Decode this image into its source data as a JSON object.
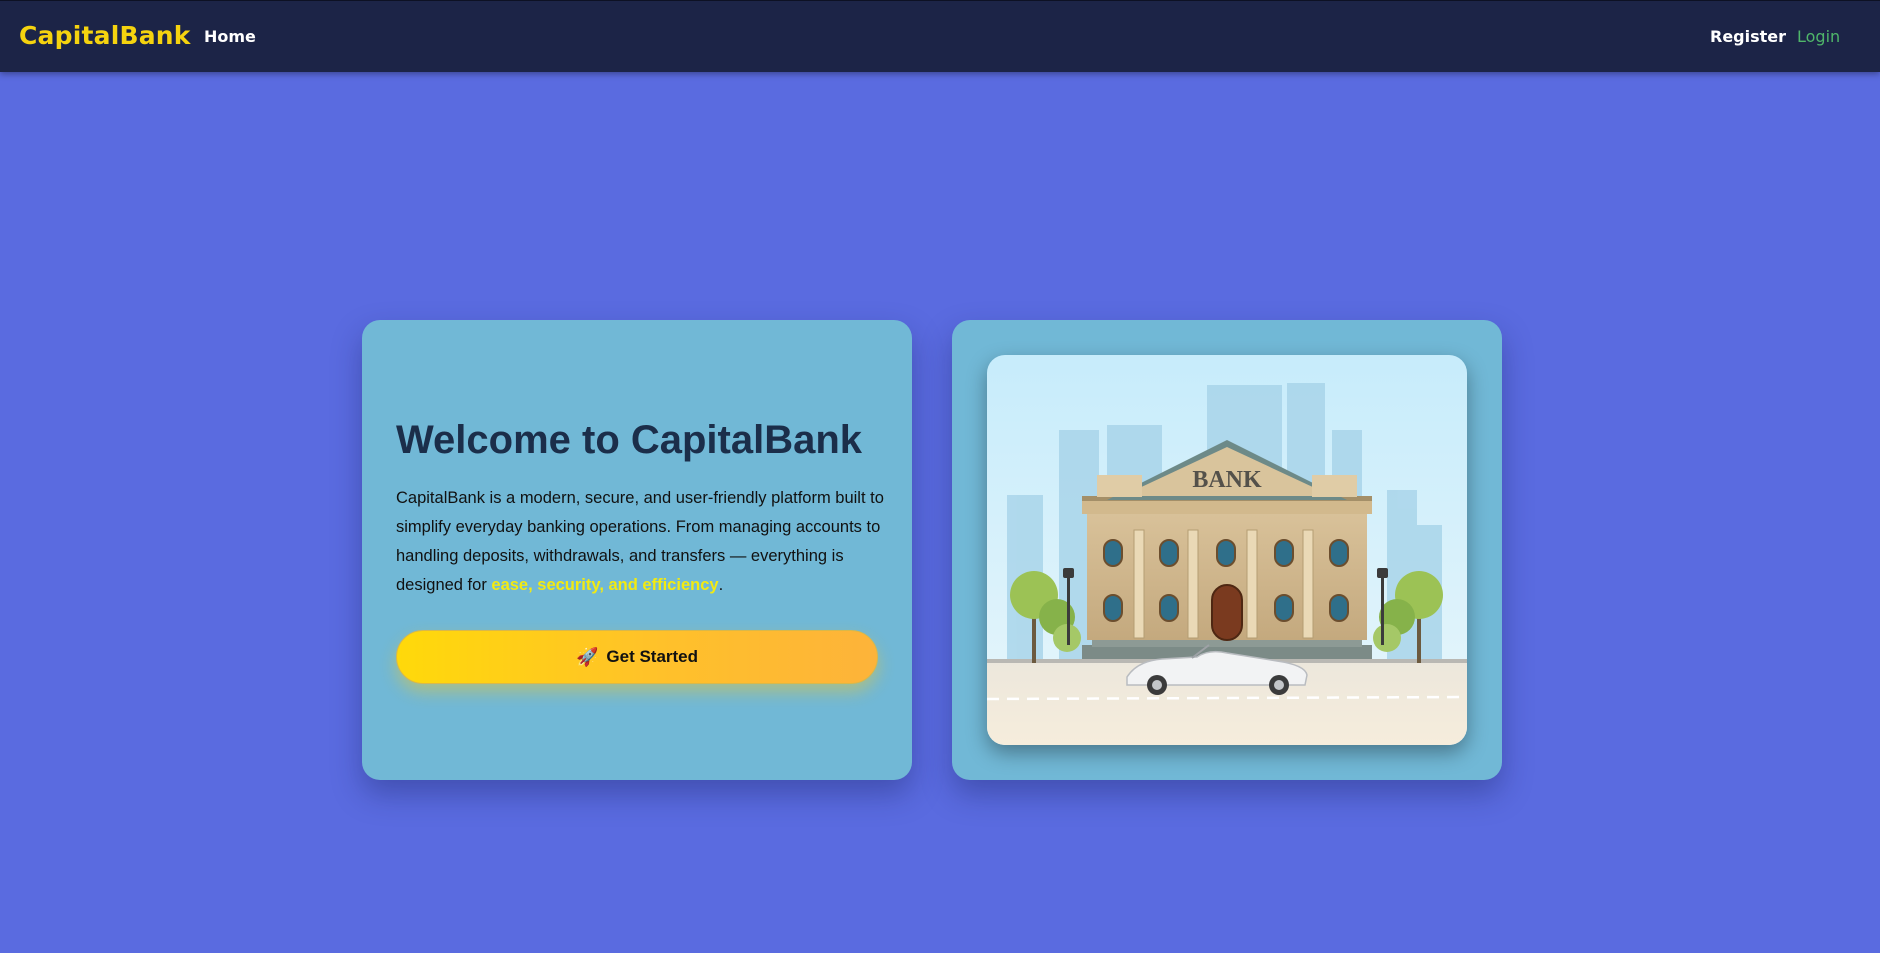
{
  "navbar": {
    "brand": "CapitalBank",
    "home": "Home",
    "register": "Register",
    "login": "Login"
  },
  "hero": {
    "title": "Welcome to CapitalBank",
    "description_before": "CapitalBank is a modern, secure, and user-friendly platform built to simplify everyday banking operations. From managing accounts to handling deposits, withdrawals, and transfers — everything is designed for ",
    "description_highlight": "ease, security, and efficiency",
    "description_after": ".",
    "cta_icon": "rocket-icon",
    "cta_label": "Get Started"
  },
  "illustration": {
    "sign_text": "BANK"
  },
  "colors": {
    "page_bg": "#5a6be0",
    "navbar_bg": "#1c2447",
    "brand": "#f5d30f",
    "card_bg": "#71b8d6",
    "title": "#1b2e4a",
    "highlight": "#f2ea12",
    "login": "#4fb66a",
    "cta_start": "#ffd90a",
    "cta_end": "#fdb33a"
  }
}
